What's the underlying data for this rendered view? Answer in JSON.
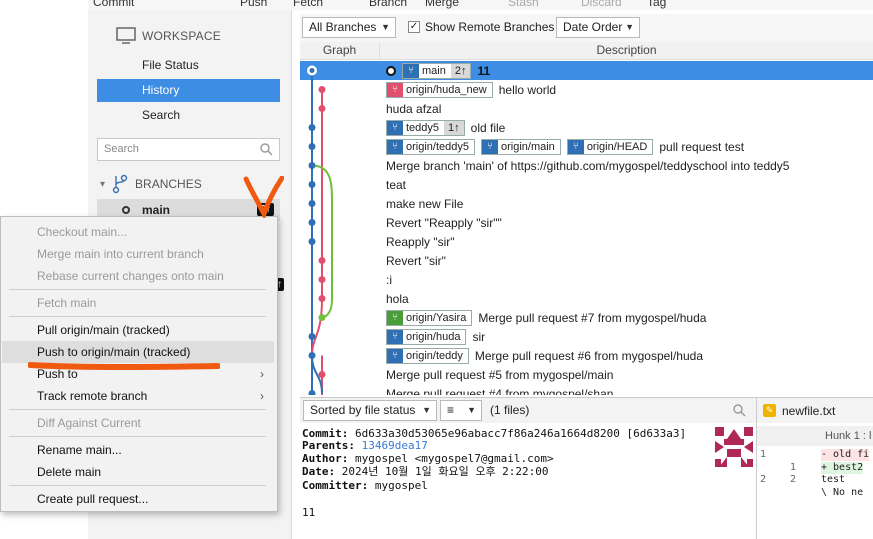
{
  "toolbar": {
    "items": [
      "Commit",
      "Push",
      "Fetch",
      "Branch",
      "Merge",
      "Stash",
      "Discard",
      "Tag"
    ]
  },
  "sidebar": {
    "workspace_label": "WORKSPACE",
    "items": [
      "File Status",
      "History",
      "Search"
    ],
    "active_item": "History",
    "search_placeholder": "Search",
    "branches_label": "BRANCHES",
    "current_branch": "main",
    "current_branch_badge": "2↑",
    "other_badge": "↑"
  },
  "filterbar": {
    "branches_dropdown": "All Branches",
    "show_remote_label": "Show Remote Branches",
    "show_remote_checked": true,
    "order_dropdown": "Date Order"
  },
  "columns": {
    "graph": "Graph",
    "description": "Description"
  },
  "commits": [
    {
      "tags": [
        {
          "name": "main",
          "color": "blue",
          "count": "2↑"
        }
      ],
      "message": "11",
      "selected": true
    },
    {
      "tags": [
        {
          "name": "origin/huda_new",
          "color": "red"
        }
      ],
      "message": "hello world"
    },
    {
      "tags": [],
      "message": "huda afzal"
    },
    {
      "tags": [
        {
          "name": "teddy5",
          "color": "blue",
          "count": "1↑"
        }
      ],
      "message": "old file"
    },
    {
      "tags": [
        {
          "name": "origin/teddy5",
          "color": "blue"
        },
        {
          "name": "origin/main",
          "color": "blue"
        },
        {
          "name": "origin/HEAD",
          "color": "blue"
        }
      ],
      "message": "pull request test"
    },
    {
      "tags": [],
      "message": "Merge branch 'main' of https://github.com/mygospel/teddyschool into teddy5"
    },
    {
      "tags": [],
      "message": "teat"
    },
    {
      "tags": [],
      "message": "make new File"
    },
    {
      "tags": [],
      "message": "Revert \"Reapply \"sir\"\""
    },
    {
      "tags": [],
      "message": "Reapply \"sir\""
    },
    {
      "tags": [],
      "message": "Revert \"sir\""
    },
    {
      "tags": [],
      "message": ":i"
    },
    {
      "tags": [],
      "message": "hola"
    },
    {
      "tags": [
        {
          "name": "origin/Yasira",
          "color": "green"
        }
      ],
      "message": "Merge pull request #7 from mygospel/huda"
    },
    {
      "tags": [
        {
          "name": "origin/huda",
          "color": "blue"
        }
      ],
      "message": "sir"
    },
    {
      "tags": [
        {
          "name": "origin/teddy",
          "color": "blue"
        }
      ],
      "message": "Merge pull request #6 from mygospel/huda"
    },
    {
      "tags": [],
      "message": "Merge pull request #5 from mygospel/main"
    },
    {
      "tags": [],
      "message": "Merge pull request #4 from mygospel/shan"
    }
  ],
  "filebar": {
    "sort_dropdown": "Sorted by file status",
    "view_dropdown": "≡",
    "file_count": "(1 files)"
  },
  "details": {
    "commit_label": "Commit:",
    "commit_value": "6d633a30d53065e96abacc7f86a246a1664d8200 [6d633a3]",
    "parents_label": "Parents:",
    "parents_value": "13469dea17",
    "author_label": "Author:",
    "author_value": "mygospel <mygospel7@gmail.com>",
    "date_label": "Date:",
    "date_value": "2024년 10월 1일 화요일 오후 2:22:00",
    "committer_label": "Committer:",
    "committer_value": "mygospel",
    "message": "11"
  },
  "diff": {
    "file_name": "newfile.txt",
    "hunk": "Hunk 1 : l",
    "lines": [
      {
        "n1": "1",
        "n2": "",
        "code": "- old fi",
        "kind": "del"
      },
      {
        "n1": "",
        "n2": "1",
        "code": "+ best2",
        "kind": "add"
      },
      {
        "n1": "2",
        "n2": "2",
        "code": "  test",
        "kind": "ctx"
      },
      {
        "n1": "",
        "n2": "",
        "code": "\\ No ne",
        "kind": "ctx"
      }
    ]
  },
  "context_menu": {
    "items": [
      {
        "label": "Checkout main...",
        "disabled": true
      },
      {
        "label": "Merge main into current branch",
        "disabled": true
      },
      {
        "label": "Rebase current changes onto main",
        "disabled": true
      },
      {
        "sep": true
      },
      {
        "label": "Fetch main",
        "disabled": true
      },
      {
        "sep": true
      },
      {
        "label": "Pull origin/main (tracked)",
        "disabled": false
      },
      {
        "label": "Push to origin/main (tracked)",
        "disabled": false,
        "hover": true
      },
      {
        "label": "Push to",
        "disabled": false,
        "submenu": true
      },
      {
        "label": "Track remote branch",
        "disabled": false,
        "submenu": true
      },
      {
        "sep": true
      },
      {
        "label": "Diff Against Current",
        "disabled": true
      },
      {
        "sep": true
      },
      {
        "label": "Rename main...",
        "disabled": false
      },
      {
        "label": "Delete main",
        "disabled": false
      },
      {
        "sep": true
      },
      {
        "label": "Create pull request...",
        "disabled": false
      }
    ]
  },
  "colors": {
    "selection": "#3d8de5",
    "graph_blue": "#2f6fb4",
    "graph_red": "#e0506e",
    "graph_green": "#6fbf3a",
    "annotation_orange": "#f05a10"
  }
}
